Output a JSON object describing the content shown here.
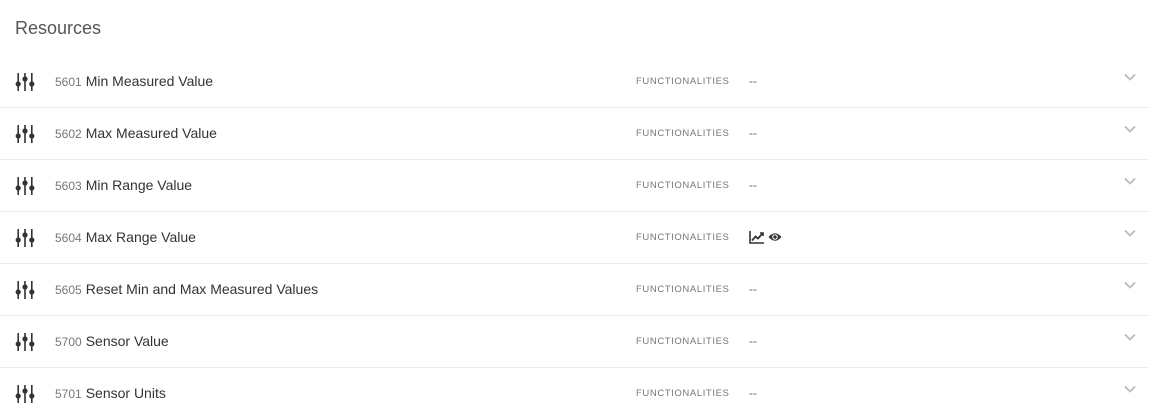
{
  "section": {
    "title": "Resources"
  },
  "resources": [
    {
      "id": "5601",
      "name": "Min Measured Value",
      "func_label": "FUNCTIONALITIES",
      "func_value": "--"
    },
    {
      "id": "5602",
      "name": "Max Measured Value",
      "func_label": "FUNCTIONALITIES",
      "func_value": "--"
    },
    {
      "id": "5603",
      "name": "Min Range Value",
      "func_label": "FUNCTIONALITIES",
      "func_value": "--"
    },
    {
      "id": "5604",
      "name": "Max Range Value",
      "func_label": "FUNCTIONALITIES",
      "func_icons": [
        "chart-line-icon",
        "eye-icon"
      ]
    },
    {
      "id": "5605",
      "name": "Reset Min and Max Measured Values",
      "func_label": "FUNCTIONALITIES",
      "func_value": "--"
    },
    {
      "id": "5700",
      "name": "Sensor Value",
      "func_label": "FUNCTIONALITIES",
      "func_value": "--"
    },
    {
      "id": "5701",
      "name": "Sensor Units",
      "func_label": "FUNCTIONALITIES",
      "func_value": "--"
    }
  ],
  "icons": {
    "row_icon": "sliders-icon",
    "expand_icon": "chevron-down-icon"
  },
  "colors": {
    "icon": "#333333",
    "chevron": "#bbbbbb",
    "divider": "#ececec"
  }
}
